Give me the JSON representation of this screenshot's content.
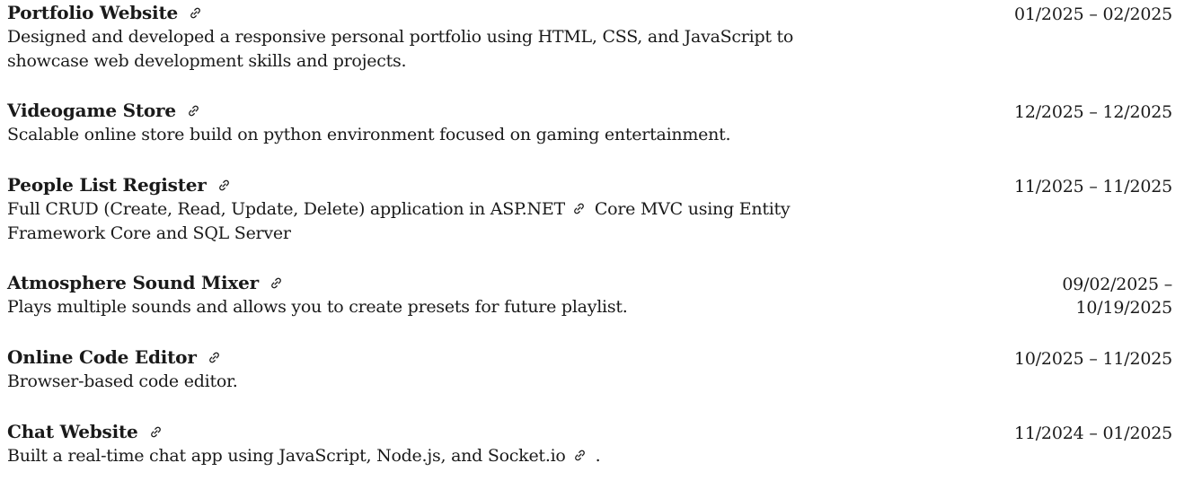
{
  "projects": [
    {
      "title": "Portfolio Website",
      "date": "01/2025 – 02/2025",
      "description": "Designed and developed a responsive personal portfolio using HTML, CSS, and JavaScript to showcase web development skills and projects."
    },
    {
      "title": "Videogame Store",
      "date": "12/2025 – 12/2025",
      "description": "Scalable online store build on python environment focused on gaming entertainment."
    },
    {
      "title": "People List Register",
      "date": "11/2025 – 11/2025",
      "description_before": "Full CRUD (Create, Read, Update, Delete) application in ASP.NET",
      "description_after": "Core MVC using Entity Framework Core and SQL Server"
    },
    {
      "title": "Atmosphere Sound Mixer",
      "date": "09/02/2025 – 10/19/2025",
      "description": "Plays multiple sounds and allows you to create presets for future playlist."
    },
    {
      "title": "Online Code Editor",
      "date": "10/2025 – 11/2025",
      "description": "Browser-based code editor."
    },
    {
      "title": "Chat Website",
      "date": "11/2024 – 01/2025",
      "description_before": "Built a real-time chat app using JavaScript, Node.js, and Socket.io",
      "description_after": "."
    }
  ],
  "icons": {
    "link": "link-icon"
  }
}
